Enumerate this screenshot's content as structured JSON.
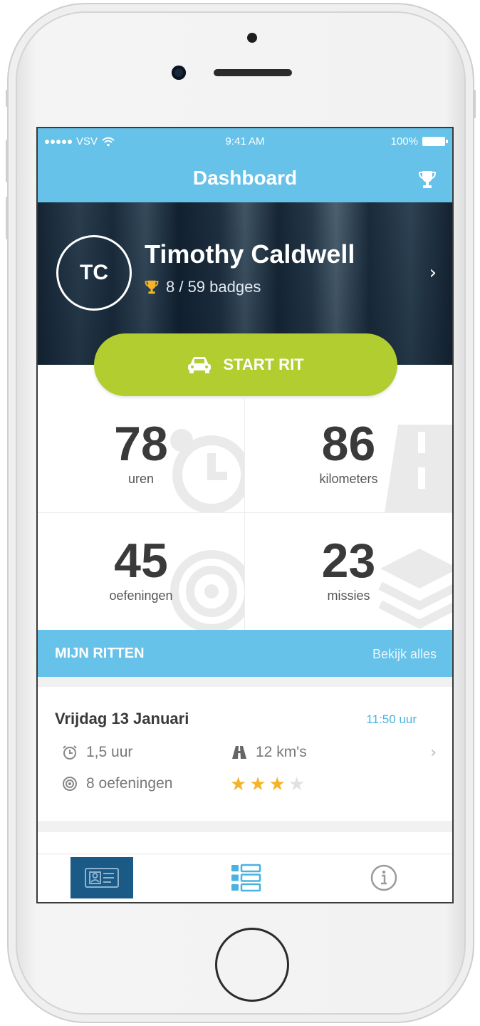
{
  "status_bar": {
    "carrier": "VSV",
    "time": "9:41 AM",
    "battery": "100%"
  },
  "nav": {
    "title": "Dashboard",
    "trophy_icon": "trophy-icon"
  },
  "profile": {
    "initials": "TC",
    "name": "Timothy Caldwell",
    "badges": "8 / 59 badges"
  },
  "start_button": {
    "label": "START RIT",
    "icon": "car-icon"
  },
  "stats": [
    {
      "value": "78",
      "label": "uren",
      "icon": "alarm-clock-icon"
    },
    {
      "value": "86",
      "label": "kilometers",
      "icon": "road-icon"
    },
    {
      "value": "45",
      "label": "oefeningen",
      "icon": "target-icon"
    },
    {
      "value": "23",
      "label": "missies",
      "icon": "layers-icon"
    }
  ],
  "rides_section": {
    "title": "MIJN RITTEN",
    "link": "Bekijk alles"
  },
  "ride": {
    "date": "Vrijdag 13 Januari",
    "time": "11:50 uur",
    "duration": "1,5 uur",
    "distance": "12 km's",
    "exercises": "8 oefeningen",
    "rating": 3,
    "rating_max": 4
  },
  "tabs": [
    {
      "name": "dashboard",
      "icon": "id-card-icon",
      "active": true
    },
    {
      "name": "list",
      "icon": "list-icon",
      "active": false
    },
    {
      "name": "info",
      "icon": "info-icon",
      "active": false
    }
  ],
  "colors": {
    "primary": "#66c2e9",
    "accent": "#b2cd2f",
    "star": "#f3b42c",
    "active_tab": "#1b5a86"
  }
}
